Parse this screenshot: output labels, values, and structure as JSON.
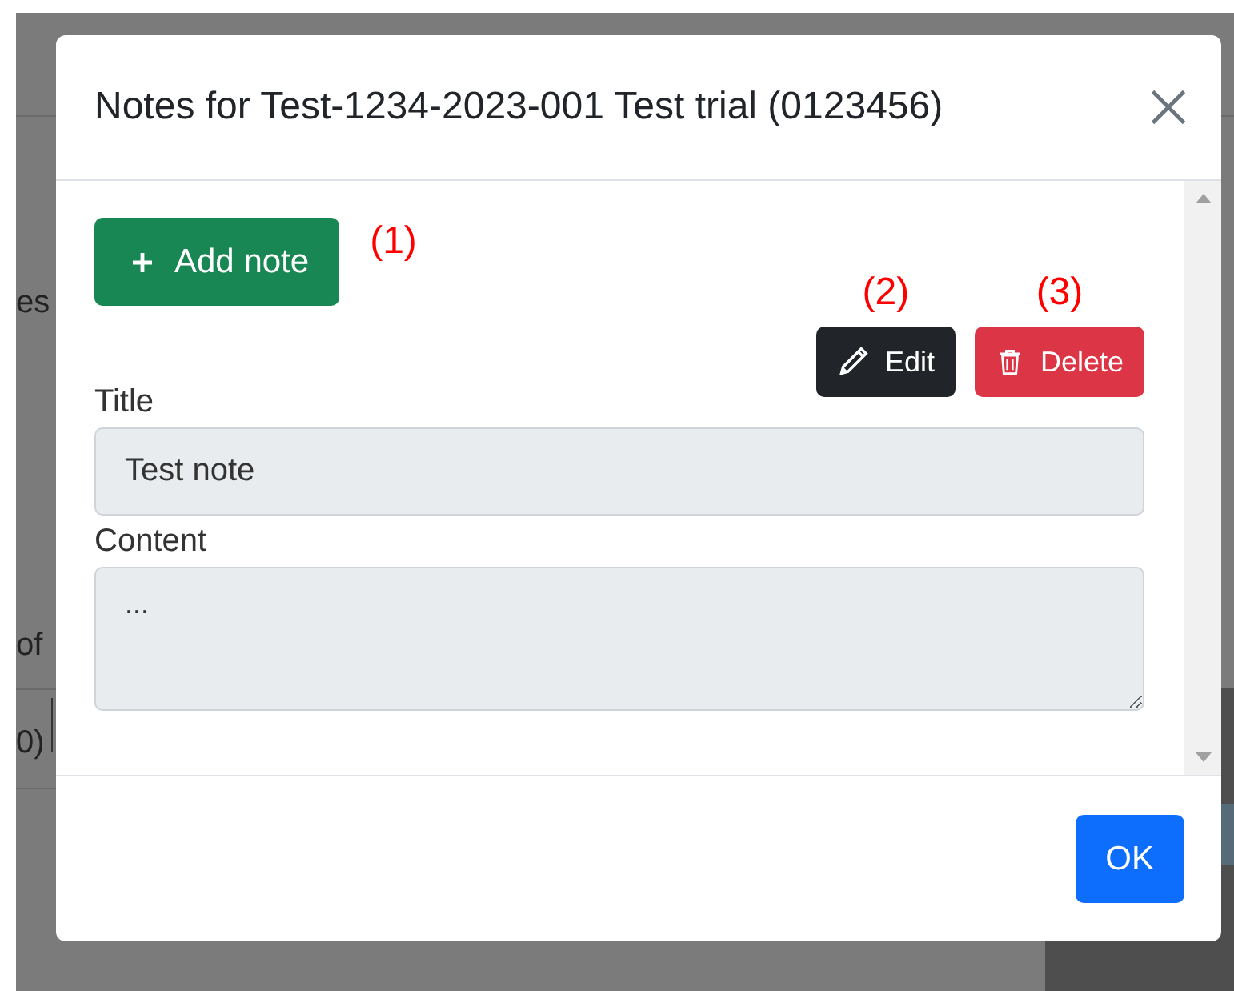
{
  "background": {
    "fragments": [
      "es",
      "of",
      "0)"
    ]
  },
  "dialog": {
    "title": "Notes for Test-1234-2023-001 Test trial (0123456)",
    "add_button": {
      "label": "Add note",
      "annotation": "(1)"
    },
    "actions": [
      {
        "label": "Edit",
        "annotation": "(2)",
        "kind": "edit"
      },
      {
        "label": "Delete",
        "annotation": "(3)",
        "kind": "delete"
      }
    ],
    "fields": [
      {
        "label": "Title",
        "value": "Test note",
        "kind": "input",
        "disabled": true
      },
      {
        "label": "Content",
        "value": "...",
        "kind": "textarea",
        "disabled": true
      }
    ],
    "ok_button": "OK"
  }
}
